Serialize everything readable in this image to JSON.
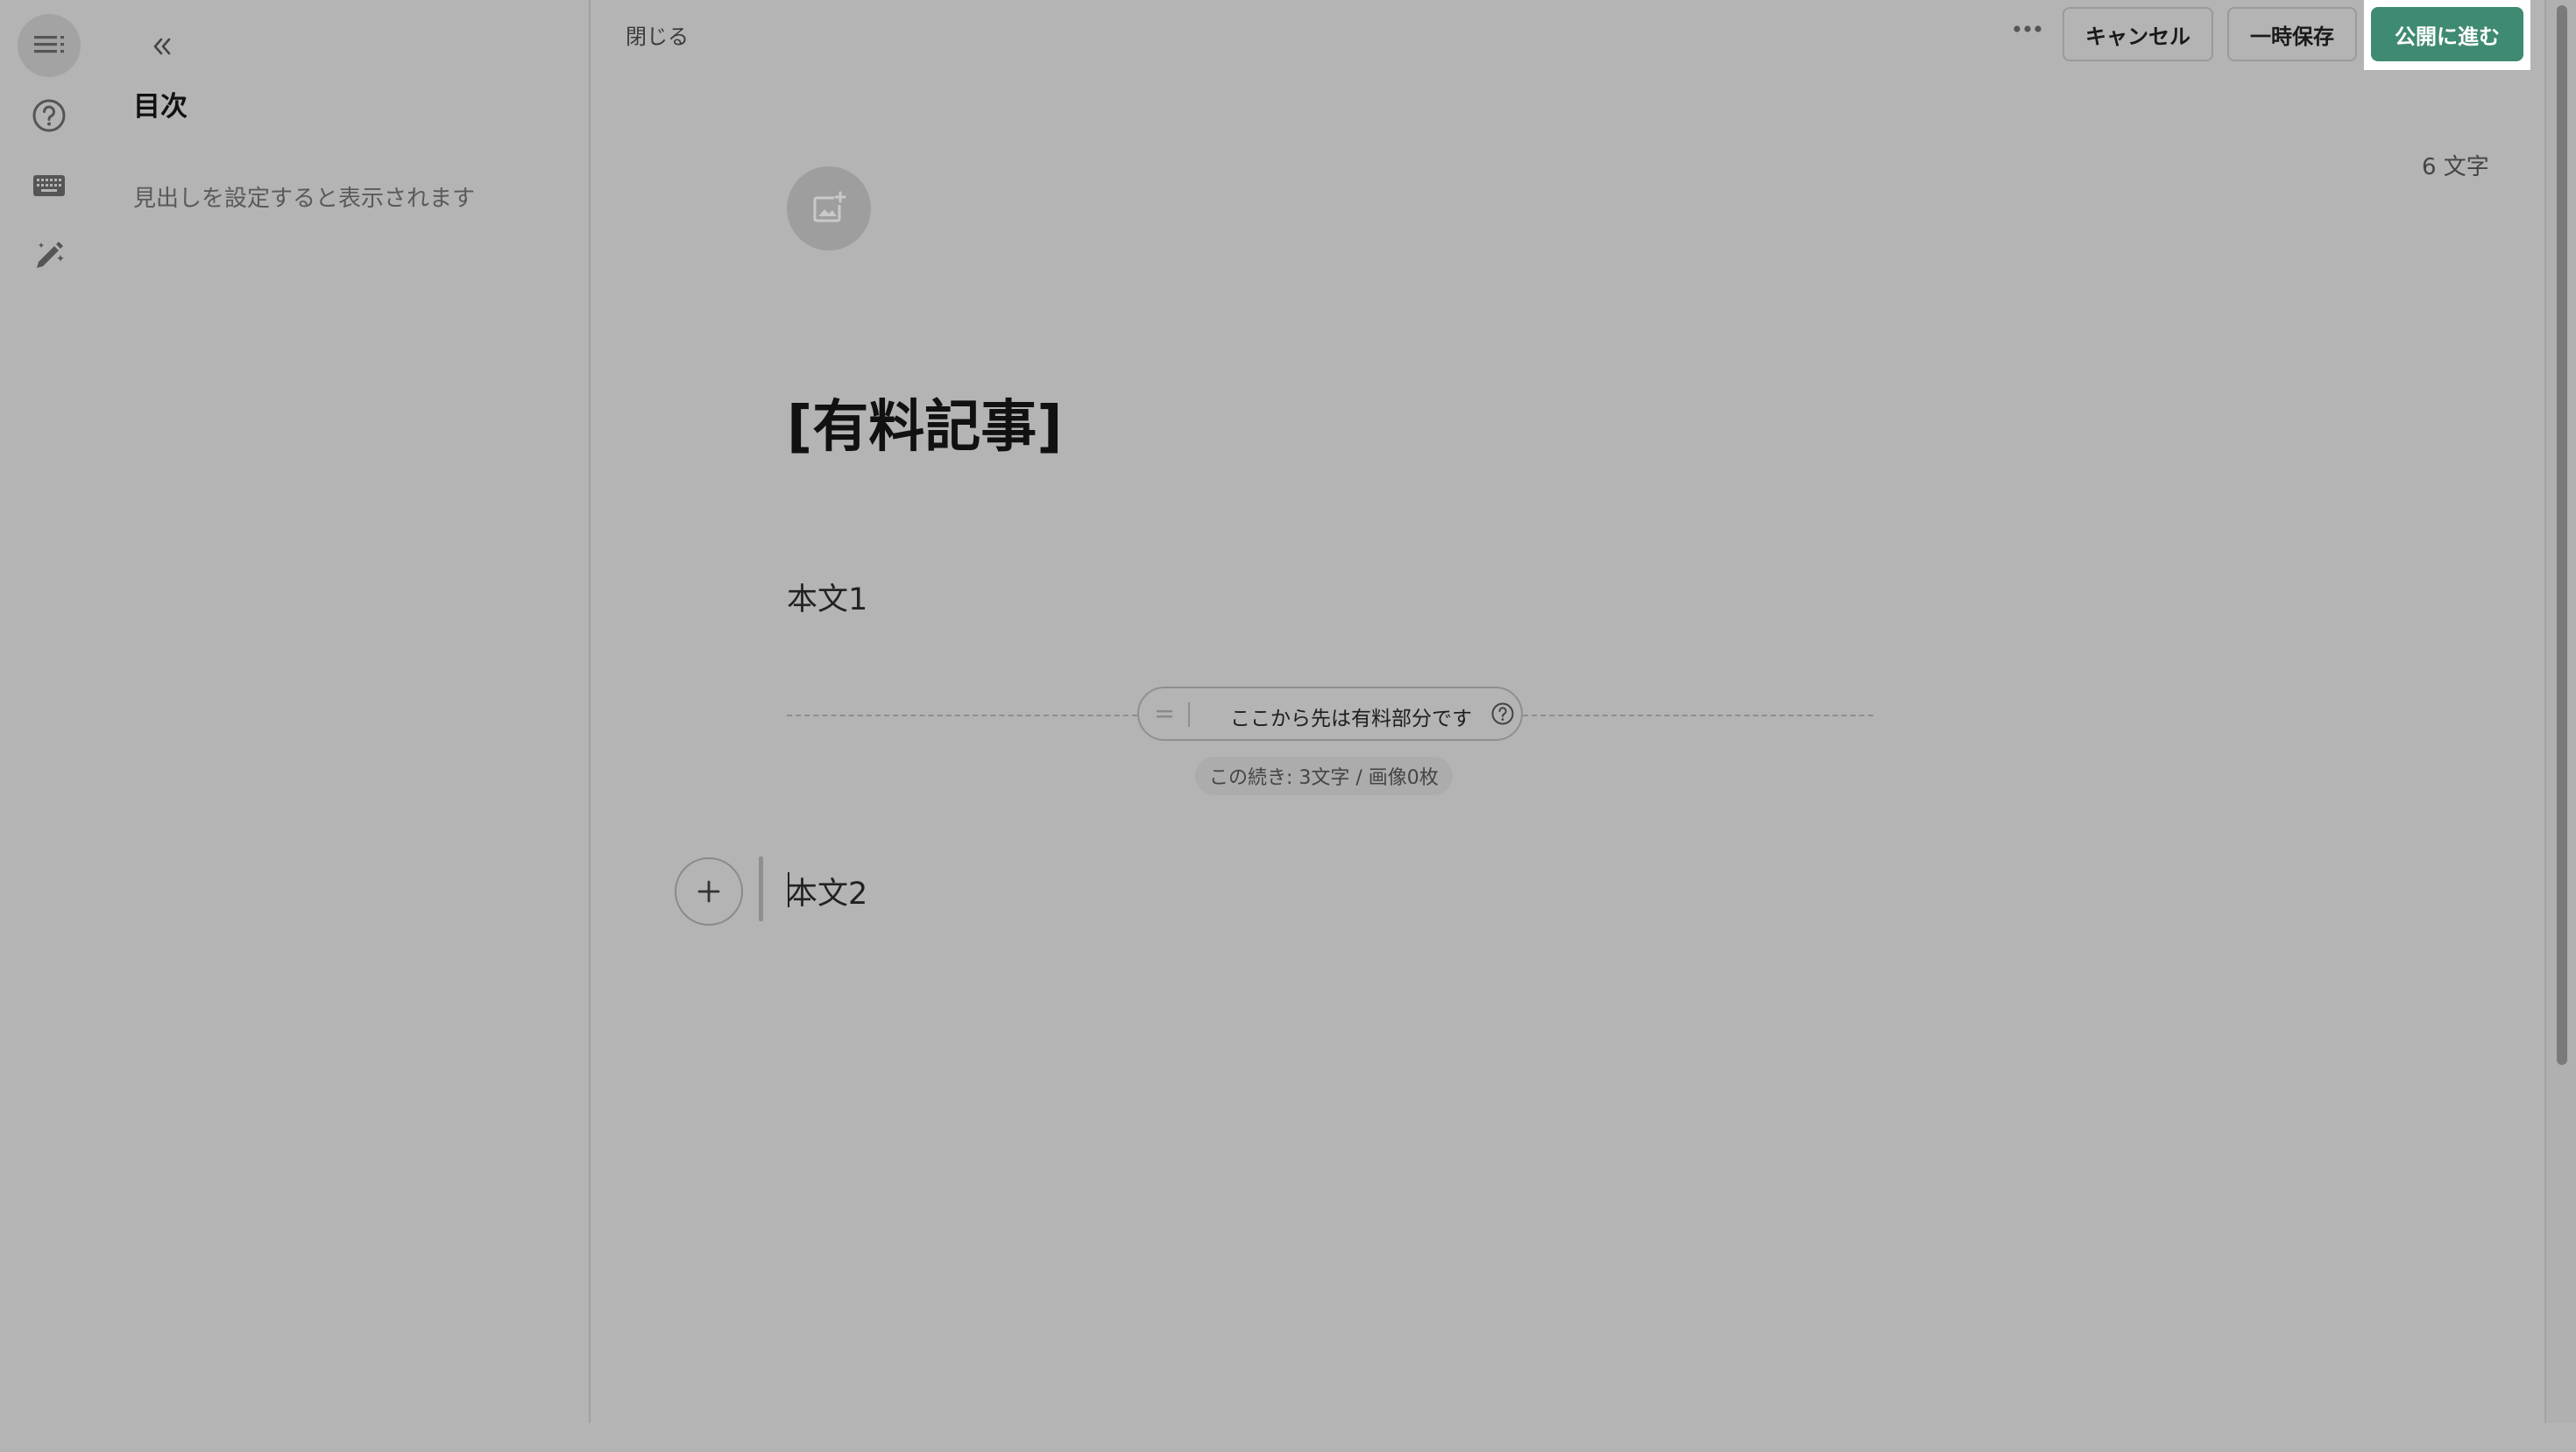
{
  "toc": {
    "title": "目次",
    "empty_message": "見出しを設定すると表示されます"
  },
  "topbar": {
    "close_label": "閉じる",
    "cancel_label": "キャンセル",
    "draft_label": "一時保存",
    "publish_label": "公開に進む",
    "colors": {
      "publish": "#3f8a72"
    }
  },
  "editor": {
    "char_count": "6 文字",
    "title": "[有料記事]",
    "body1": "本文1",
    "paywall": {
      "label": "ここから先は有料部分です",
      "info": "この続き: 3文字 / 画像0枚"
    },
    "body2": "本文2"
  },
  "icons": {
    "rail": [
      "toc-icon",
      "help-icon",
      "keyboard-icon",
      "pen-icon"
    ],
    "collapse": "double-chevron-left-icon",
    "more": "more-horizontal-icon",
    "image_add": "image-add-icon",
    "add_block": "plus-icon"
  }
}
